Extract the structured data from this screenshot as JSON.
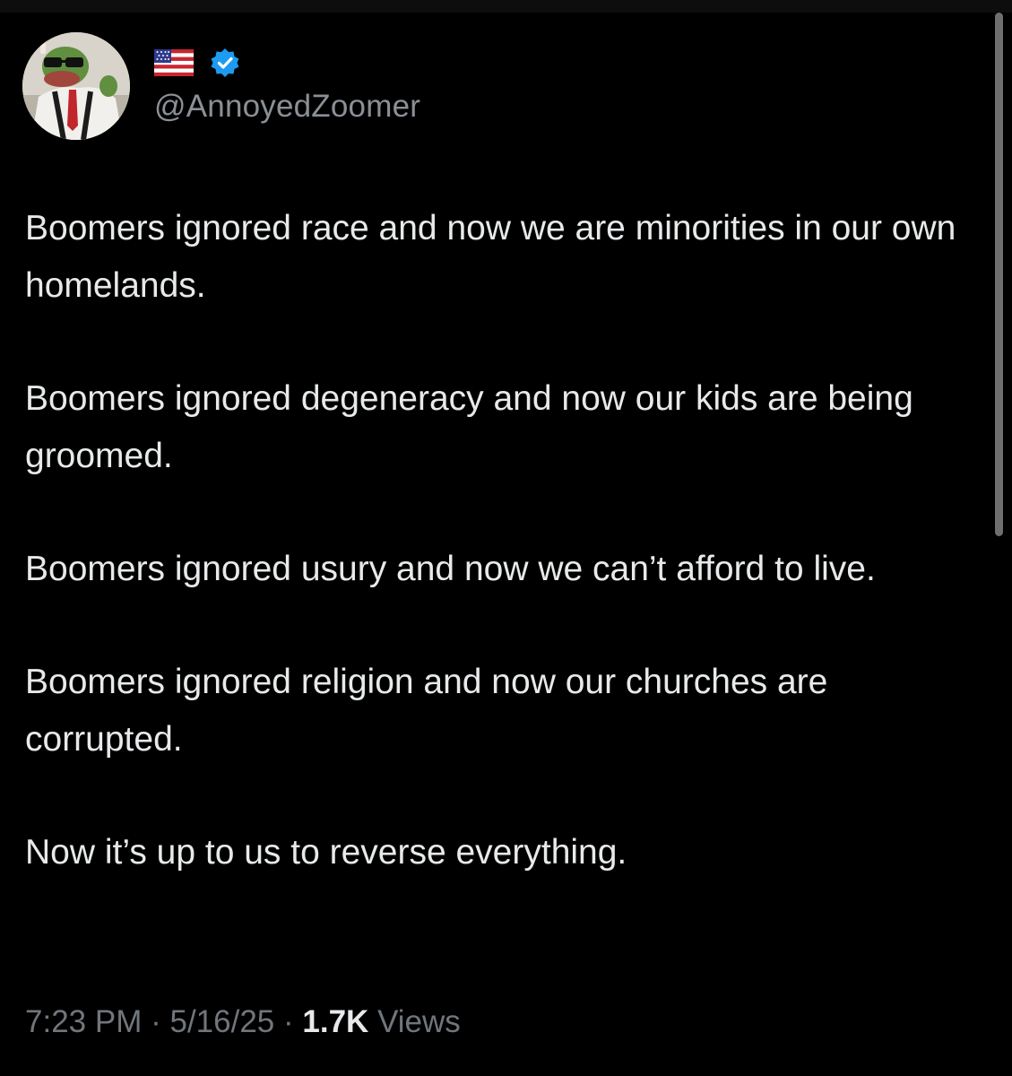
{
  "author": {
    "handle": "@AnnoyedZoomer",
    "flag_emoji": "🇺🇸",
    "avatar_icon": "pepe-avatar-icon",
    "verified_icon": "verified-badge-icon",
    "verified_color": "#1d9bf0"
  },
  "tweet": {
    "paragraphs": [
      "Boomers ignored race and now we are minorities in our own homelands.",
      "Boomers ignored degeneracy and now our kids are being groomed.",
      "Boomers ignored usury and now we can’t afford to live.",
      "Boomers ignored religion and now our churches are corrupted.",
      "Now it’s up to us to reverse everything."
    ]
  },
  "meta": {
    "time": "7:23 PM",
    "separator": "·",
    "date": "5/16/25",
    "views_count": "1.7K",
    "views_label": "Views"
  },
  "colors": {
    "background": "#000000",
    "text": "#e7e9ea",
    "secondary_text": "#71767b"
  }
}
